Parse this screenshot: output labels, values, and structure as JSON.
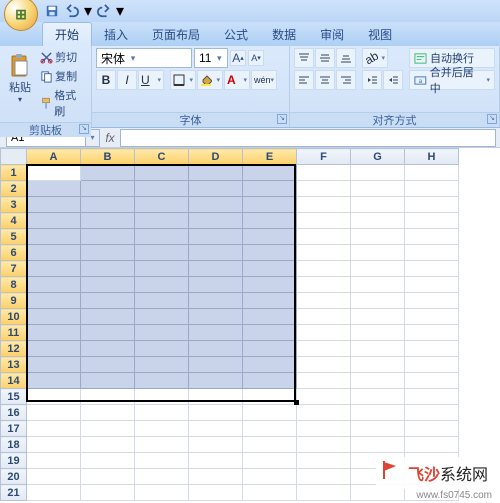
{
  "qat": {
    "save": "save",
    "undo": "undo",
    "redo": "redo"
  },
  "tabs": [
    "开始",
    "插入",
    "页面布局",
    "公式",
    "数据",
    "审阅",
    "视图"
  ],
  "active_tab": 0,
  "clipboard": {
    "paste": "粘贴",
    "cut": "剪切",
    "copy": "复制",
    "format_painter": "格式刷",
    "group": "剪贴板"
  },
  "font": {
    "name": "宋体",
    "size": "11",
    "grow": "A",
    "shrink": "A",
    "bold": "B",
    "italic": "I",
    "underline": "U",
    "group": "字体"
  },
  "align": {
    "wrap": "自动换行",
    "merge": "合并后居中",
    "group": "对齐方式"
  },
  "namebox": "A1",
  "columns": [
    "A",
    "B",
    "C",
    "D",
    "E",
    "F",
    "G",
    "H"
  ],
  "rows": [
    1,
    2,
    3,
    4,
    5,
    6,
    7,
    8,
    9,
    10,
    11,
    12,
    13,
    14,
    15,
    16,
    17,
    18,
    19,
    20,
    21
  ],
  "selection": {
    "r1": 1,
    "c1": 1,
    "r2": 14,
    "c2": 5,
    "active": "A1"
  },
  "watermark": {
    "text_bold": "飞沙",
    "text": "系统网",
    "url": "www.fs0745.com"
  }
}
